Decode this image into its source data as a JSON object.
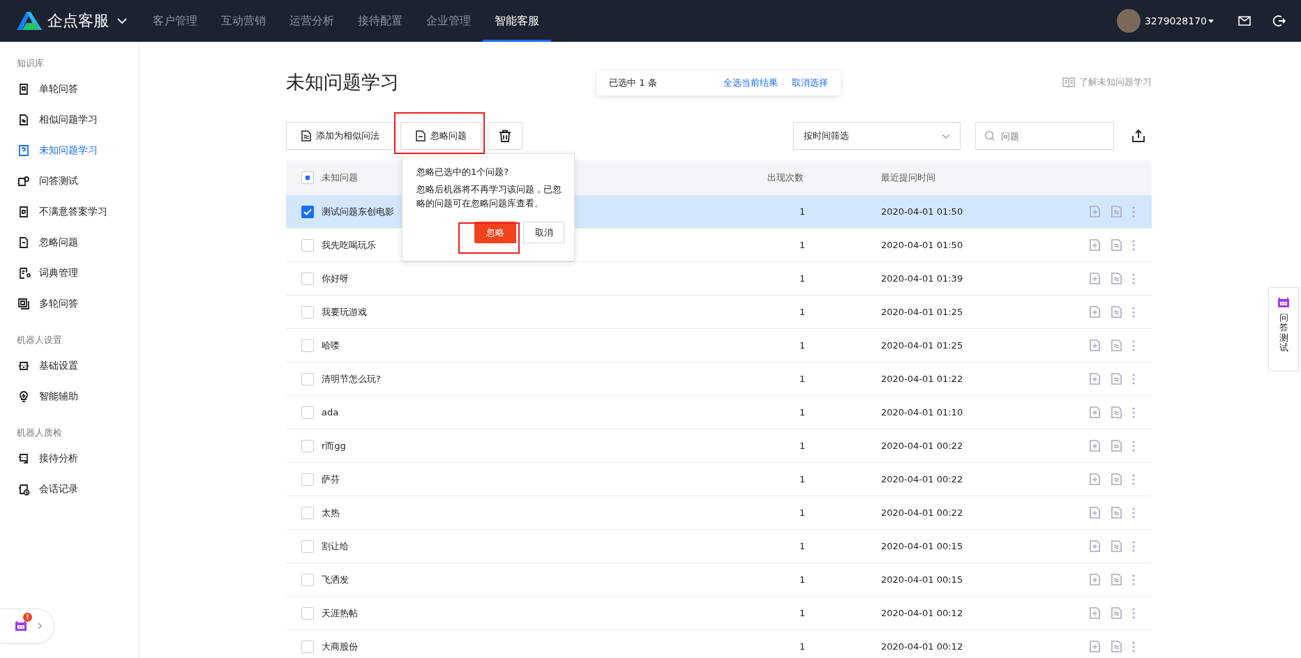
{
  "topbar": {
    "brand": "企点客服",
    "nav": [
      {
        "label": "客户管理",
        "selected": false
      },
      {
        "label": "互动营销",
        "selected": false
      },
      {
        "label": "运营分析",
        "selected": false
      },
      {
        "label": "接待配置",
        "selected": false
      },
      {
        "label": "企业管理",
        "selected": false
      },
      {
        "label": "智能客服",
        "selected": true
      }
    ],
    "username": "3279028170"
  },
  "sidebar": {
    "sections": [
      {
        "title": "知识库",
        "items": [
          {
            "label": "单轮问答",
            "selected": false
          },
          {
            "label": "相似问题学习",
            "selected": false
          },
          {
            "label": "未知问题学习",
            "selected": true
          },
          {
            "label": "问答测试",
            "selected": false
          },
          {
            "label": "不满意答案学习",
            "selected": false
          },
          {
            "label": "忽略问题",
            "selected": false
          },
          {
            "label": "词典管理",
            "selected": false
          },
          {
            "label": "多轮问答",
            "selected": false
          }
        ]
      },
      {
        "title": "机器人设置",
        "items": [
          {
            "label": "基础设置",
            "selected": false
          },
          {
            "label": "智能辅助",
            "selected": false
          }
        ]
      },
      {
        "title": "机器人质检",
        "items": [
          {
            "label": "接待分析",
            "selected": false
          },
          {
            "label": "会话记录",
            "selected": false
          }
        ]
      }
    ],
    "assistant_badge": "!"
  },
  "page": {
    "title": "未知问题学习",
    "selection_bar": {
      "text": "已选中 1 条",
      "select_all": "全选当前结果",
      "clear": "取消选择"
    },
    "help_link": "了解未知问题学习"
  },
  "toolbar": {
    "add_similar": "添加为相似问法",
    "ignore": "忽略问题",
    "filter": {
      "value": "按时间筛选"
    },
    "search": {
      "placeholder": "问题"
    }
  },
  "table": {
    "select_all_partial": true,
    "columns": [
      "未知问题",
      "出现次数",
      "最近提问时间"
    ],
    "rows": [
      {
        "question": "测试问题东创电影",
        "count": "1",
        "time": "2020-04-01 01:50",
        "selected": true
      },
      {
        "question": "我先吃喝玩乐",
        "count": "1",
        "time": "2020-04-01 01:50",
        "selected": false
      },
      {
        "question": "你好呀",
        "count": "1",
        "time": "2020-04-01 01:39",
        "selected": false
      },
      {
        "question": "我要玩游戏",
        "count": "1",
        "time": "2020-04-01 01:25",
        "selected": false
      },
      {
        "question": "哈喽",
        "count": "1",
        "time": "2020-04-01 01:25",
        "selected": false
      },
      {
        "question": "清明节怎么玩?",
        "count": "1",
        "time": "2020-04-01 01:22",
        "selected": false
      },
      {
        "question": "ada",
        "count": "1",
        "time": "2020-04-01 01:10",
        "selected": false
      },
      {
        "question": "r而gg",
        "count": "1",
        "time": "2020-04-01 00:22",
        "selected": false
      },
      {
        "question": "萨芬",
        "count": "1",
        "time": "2020-04-01 00:22",
        "selected": false
      },
      {
        "question": "太热",
        "count": "1",
        "time": "2020-04-01 00:22",
        "selected": false
      },
      {
        "question": "割让给",
        "count": "1",
        "time": "2020-04-01 00:15",
        "selected": false
      },
      {
        "question": "飞洒发",
        "count": "1",
        "time": "2020-04-01 00:15",
        "selected": false
      },
      {
        "question": "天涯热帖",
        "count": "1",
        "time": "2020-04-01 00:12",
        "selected": false
      },
      {
        "question": "大商股份",
        "count": "1",
        "time": "2020-04-01 00:12",
        "selected": false
      }
    ]
  },
  "confirm_popup": {
    "title": "忽略已选中的1个问题?",
    "message": "忽略后机器将不再学习该问题，已忽略的问题可在忽略问题库查看。",
    "confirm": "忽略",
    "cancel": "取消"
  },
  "side_widget": {
    "label": "问答测试"
  }
}
